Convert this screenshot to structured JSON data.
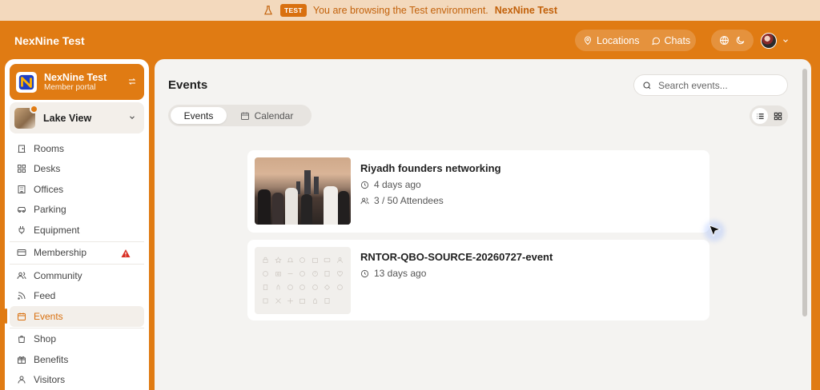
{
  "banner": {
    "badge": "TEST",
    "message": "You are browsing the Test environment.",
    "org": "NexNine Test"
  },
  "header": {
    "brand": "NexNine Test",
    "locations_label": "Locations",
    "chats_label": "Chats"
  },
  "sidebar": {
    "org_name": "NexNine Test",
    "org_sub": "Member portal",
    "location": "Lake View",
    "items": [
      {
        "label": "Rooms",
        "icon": "door-icon"
      },
      {
        "label": "Desks",
        "icon": "grid-icon"
      },
      {
        "label": "Offices",
        "icon": "building-icon"
      },
      {
        "label": "Parking",
        "icon": "car-icon"
      },
      {
        "label": "Equipment",
        "icon": "plug-icon"
      },
      {
        "label": "Membership",
        "icon": "card-icon"
      },
      {
        "label": "Community",
        "icon": "people-icon"
      },
      {
        "label": "Feed",
        "icon": "rss-icon"
      },
      {
        "label": "Events",
        "icon": "calendar-icon"
      },
      {
        "label": "Shop",
        "icon": "bag-icon"
      },
      {
        "label": "Benefits",
        "icon": "gift-icon"
      },
      {
        "label": "Visitors",
        "icon": "person-icon"
      }
    ],
    "active": "Events",
    "warning_color": "#D93025"
  },
  "main": {
    "title": "Events",
    "search_placeholder": "Search events...",
    "tabs": [
      "Events",
      "Calendar"
    ],
    "active_tab": "Events",
    "events": [
      {
        "title": "Riyadh founders networking",
        "when": "4 days ago",
        "attendees": "3 / 50 Attendees"
      },
      {
        "title": "RNTOR-QBO-SOURCE-20260727-event",
        "when": "13 days ago"
      }
    ]
  },
  "colors": {
    "accent": "#E07B13",
    "banner_bg": "#F3D9BD",
    "main_bg": "#F4F3F1"
  }
}
